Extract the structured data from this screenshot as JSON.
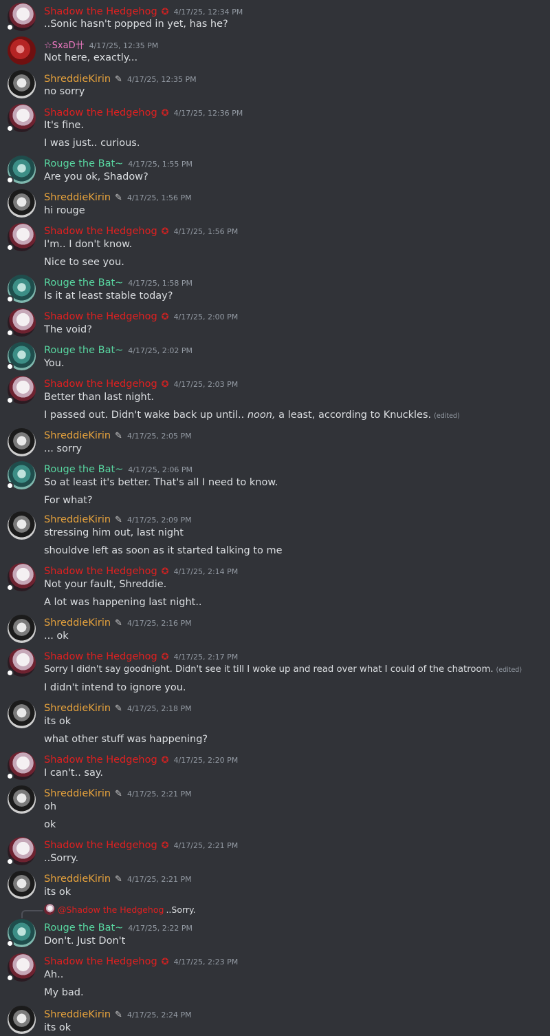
{
  "users": {
    "shadow": {
      "name": "Shadow the Hedgehog",
      "color": "#e02020",
      "icon": "shadow-emblem-icon"
    },
    "shreddie": {
      "name": "ShreddieKirin",
      "color": "#e6a23c",
      "icon": "wrench-icon"
    },
    "rouge": {
      "name": "Rouge the Bat~",
      "color": "#58d6a0"
    },
    "sxad": {
      "name": "☆SxaD卄",
      "color": "#f07ac4",
      "icon": "sparkle-icon"
    }
  },
  "messages": [
    {
      "user": "Shadow the Hedgehog",
      "time": "4/17/25, 12:34 PM",
      "lines": [
        "..Sonic hasn't popped in yet, has he?"
      ]
    },
    {
      "user": "☆SxaD卄",
      "time": "4/17/25, 12:35 PM",
      "lines": [
        "Not here, exactly..."
      ]
    },
    {
      "user": "ShreddieKirin",
      "time": "4/17/25, 12:35 PM",
      "lines": [
        "no sorry"
      ]
    },
    {
      "user": "Shadow the Hedgehog",
      "time": "4/17/25, 12:36 PM",
      "lines": [
        "It's fine.",
        "I was just.. curious."
      ]
    },
    {
      "user": "Rouge the Bat~",
      "time": "4/17/25, 1:55 PM",
      "lines": [
        "Are you ok, Shadow?"
      ]
    },
    {
      "user": "ShreddieKirin",
      "time": "4/17/25, 1:56 PM",
      "lines": [
        "hi rouge"
      ]
    },
    {
      "user": "Shadow the Hedgehog",
      "time": "4/17/25, 1:56 PM",
      "lines": [
        "I'm.. I don't know.",
        "Nice to see you."
      ]
    },
    {
      "user": "Rouge the Bat~",
      "time": "4/17/25, 1:58 PM",
      "lines": [
        "Is it at least stable today?"
      ]
    },
    {
      "user": "Shadow the Hedgehog",
      "time": "4/17/25, 2:00 PM",
      "lines": [
        "The void?"
      ]
    },
    {
      "user": "Rouge the Bat~",
      "time": "4/17/25, 2:02 PM",
      "lines": [
        "You."
      ]
    },
    {
      "user": "Shadow the Hedgehog",
      "time": "4/17/25, 2:03 PM",
      "lines": [
        "Better than last night."
      ],
      "line2": {
        "before": "I passed out. Didn't wake back up until.. ",
        "emph": "noon,",
        "after": " a least, according to Knuckles.",
        "edited": "(edited)"
      }
    },
    {
      "user": "ShreddieKirin",
      "time": "4/17/25, 2:05 PM",
      "lines": [
        "... sorry"
      ]
    },
    {
      "user": "Rouge the Bat~",
      "time": "4/17/25, 2:06 PM",
      "lines": [
        "So at least it's better. That's all I need to know.",
        "For what?"
      ]
    },
    {
      "user": "ShreddieKirin",
      "time": "4/17/25, 2:09 PM",
      "lines": [
        "stressing him out, last night",
        "shouldve left as soon as it started talking to me"
      ]
    },
    {
      "user": "Shadow the Hedgehog",
      "time": "4/17/25, 2:14 PM",
      "lines": [
        "Not your fault, Shreddie.",
        "A lot was happening last night.."
      ]
    },
    {
      "user": "ShreddieKirin",
      "time": "4/17/25, 2:16 PM",
      "lines": [
        "... ok"
      ]
    },
    {
      "user": "Shadow the Hedgehog",
      "time": "4/17/25, 2:17 PM",
      "lines": [
        "Sorry I didn't say goodnight. Didn't see it till I woke up and read over what I could of the chatroom.",
        "I didn't intend to ignore you."
      ],
      "edited": "(edited)"
    },
    {
      "user": "ShreddieKirin",
      "time": "4/17/25, 2:18 PM",
      "lines": [
        "its ok",
        "what other stuff was happening?"
      ]
    },
    {
      "user": "Shadow the Hedgehog",
      "time": "4/17/25, 2:20 PM",
      "lines": [
        "I can't.. say."
      ]
    },
    {
      "user": "ShreddieKirin",
      "time": "4/17/25, 2:21 PM",
      "lines": [
        "oh",
        "ok"
      ]
    },
    {
      "user": "Shadow the Hedgehog",
      "time": "4/17/25, 2:21 PM",
      "lines": [
        "..Sorry."
      ]
    },
    {
      "user": "ShreddieKirin",
      "time": "4/17/25, 2:21 PM",
      "lines": [
        "its ok"
      ]
    },
    {
      "user": "Rouge the Bat~",
      "time": "4/17/25, 2:22 PM",
      "lines": [
        "Don't. Just Don't"
      ],
      "reply": {
        "mention": "@Shadow the Hedgehog",
        "text": "..Sorry."
      }
    },
    {
      "user": "Shadow the Hedgehog",
      "time": "4/17/25, 2:23 PM",
      "lines": [
        "Ah..",
        "My bad."
      ]
    },
    {
      "user": "ShreddieKirin",
      "time": "4/17/25, 2:24 PM",
      "lines": [
        "its ok"
      ]
    }
  ]
}
